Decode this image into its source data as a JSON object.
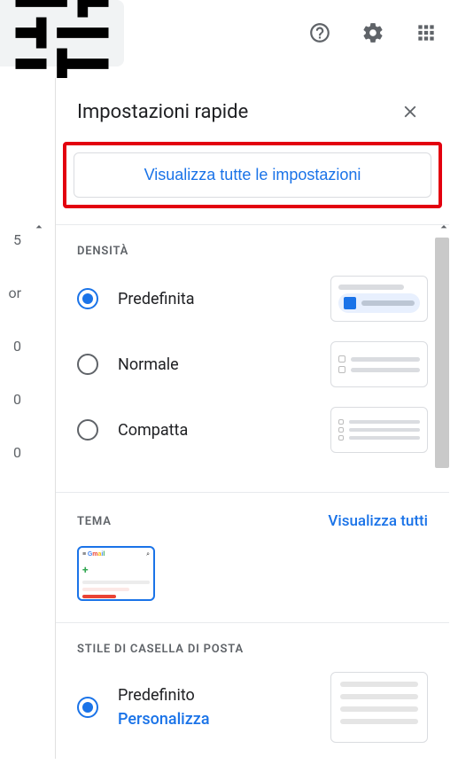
{
  "topbar": {
    "tune_icon": "tune",
    "help_icon": "help",
    "settings_icon": "settings",
    "apps_icon": "apps"
  },
  "left_numbers": [
    "5",
    "or",
    "0",
    "0",
    "0"
  ],
  "panel": {
    "title": "Impostazioni rapide",
    "close_icon": "close",
    "view_all_button": "Visualizza tutte le impostazioni"
  },
  "density": {
    "title": "DENSITÀ",
    "options": [
      {
        "label": "Predefinita",
        "selected": true
      },
      {
        "label": "Normale",
        "selected": false
      },
      {
        "label": "Compatta",
        "selected": false
      }
    ]
  },
  "theme": {
    "title": "TEMA",
    "view_all": "Visualizza tutti",
    "thumb_label": "Gmail"
  },
  "inbox_style": {
    "title": "STILE DI CASELLA DI POSTA",
    "options": [
      {
        "label": "Predefinito",
        "customize": "Personalizza",
        "selected": true
      }
    ]
  }
}
